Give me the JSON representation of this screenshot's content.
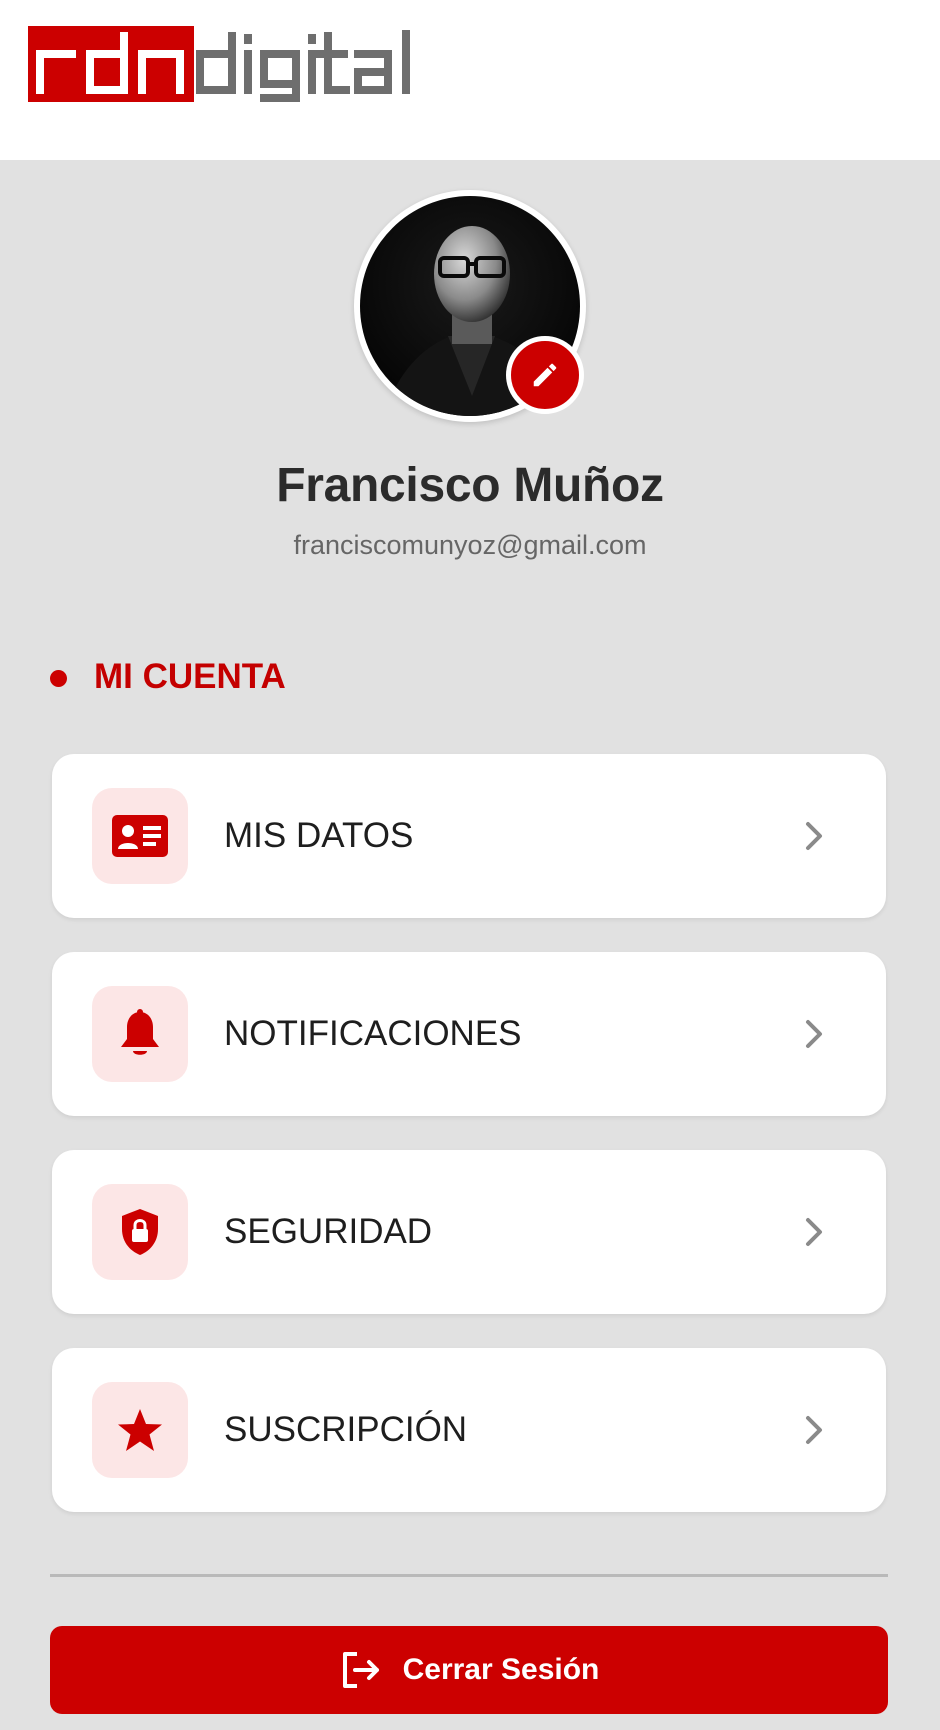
{
  "brand": {
    "logo_text": "rdndigital",
    "colors": {
      "accent": "#cc0000",
      "accent_soft": "#fce6e6",
      "background": "#e1e1e1",
      "logo_gray": "#6e6e6e"
    }
  },
  "profile": {
    "name": "Francisco Muñoz",
    "email": "franciscomunyoz@gmail.com",
    "avatar_icon": "profile-photo",
    "edit_icon": "pencil-icon"
  },
  "section": {
    "title": "MI CUENTA"
  },
  "menu": {
    "items": [
      {
        "label": "MIS DATOS",
        "icon": "id-card-icon"
      },
      {
        "label": "NOTIFICACIONES",
        "icon": "bell-icon"
      },
      {
        "label": "SEGURIDAD",
        "icon": "shield-lock-icon"
      },
      {
        "label": "SUSCRIPCIÓN",
        "icon": "star-icon"
      }
    ],
    "chevron_icon": "chevron-right-icon"
  },
  "logout": {
    "label": "Cerrar Sesión",
    "icon": "logout-icon"
  }
}
